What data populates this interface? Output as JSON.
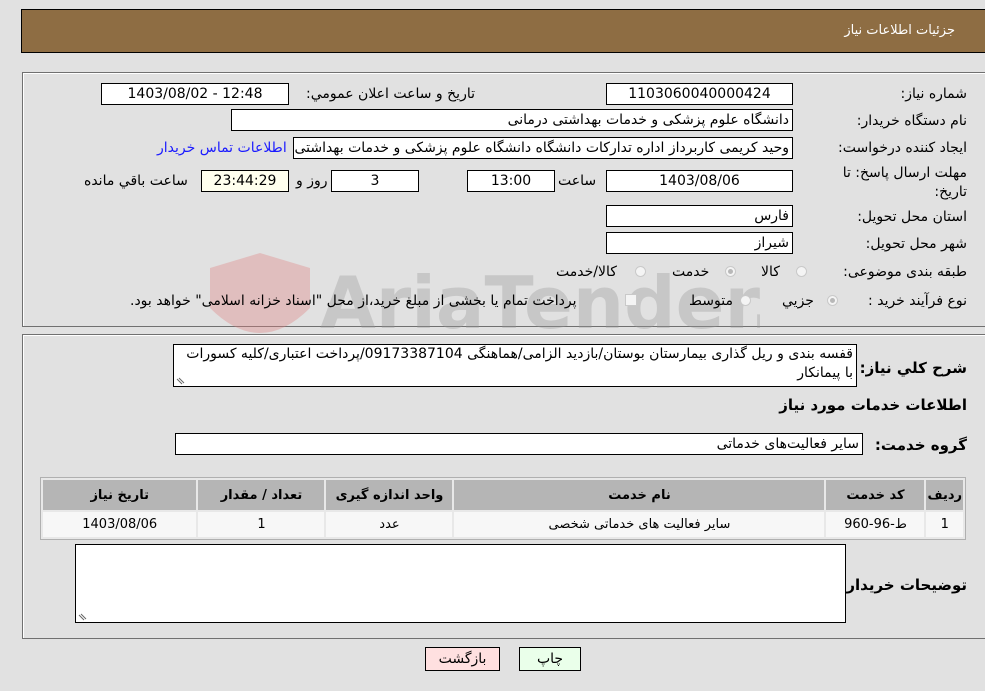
{
  "header": {
    "title": "جزئیات اطلاعات نیاز"
  },
  "form": {
    "need_number": {
      "label": "شماره نیاز:",
      "value": "1103060040000424"
    },
    "announce_datetime": {
      "label": "تاریخ و ساعت اعلان عمومي:",
      "value": "1403/08/02 - 12:48"
    },
    "buyer_org": {
      "label": "نام دستگاه خریدار:",
      "value": "دانشگاه علوم پزشکی و خدمات بهداشتی درمانی"
    },
    "requester": {
      "label": "ایجاد کننده درخواست:",
      "value": "وحید کریمی کاربرداز اداره تدارکات دانشگاه دانشگاه علوم پزشکی و خدمات بهداشتی درمانی",
      "contact_link": "اطلاعات تماس خریدار"
    },
    "deadline": {
      "label": "مهلت ارسال پاسخ: تا تاریخ:",
      "date": "1403/08/06",
      "time_label": "ساعت",
      "time": "13:00",
      "days": "3",
      "days_label": "روز و",
      "remaining": "23:44:29",
      "remaining_label": "ساعت باقي مانده"
    },
    "province": {
      "label": "استان محل تحویل:",
      "value": "فارس"
    },
    "city": {
      "label": "شهر محل تحویل:",
      "value": "شیراز"
    },
    "category": {
      "label": "طبقه بندی موضوعی:",
      "options": [
        {
          "label": "کالا",
          "checked": false
        },
        {
          "label": "خدمت",
          "checked": true
        },
        {
          "label": "کالا/خدمت",
          "checked": false
        }
      ]
    },
    "purchase_type": {
      "label": "نوع فرآیند خرید :",
      "options": [
        {
          "label": "جزيي",
          "checked": true
        },
        {
          "label": "متوسط",
          "checked": false
        }
      ],
      "treasury_checkbox": {
        "label": "پرداخت تمام یا بخشی از مبلغ خرید،از محل \"اسناد خزانه اسلامی\" خواهد بود.",
        "checked": false
      }
    }
  },
  "details": {
    "description_label": "شرح کلي نیاز:",
    "description": "قفسه بندی و ریل گذاری بیمارستان بوستان/بازدید الزامی/هماهنگی 09173387104/پرداخت اعتباری/کلیه کسورات با پیمانکار",
    "services_title": "اطلاعات خدمات مورد نیاز",
    "service_group_label": "گروه خدمت:",
    "service_group": "سایر فعالیت‌های خدماتی",
    "table": {
      "headers": [
        "ردیف",
        "کد خدمت",
        "نام خدمت",
        "واحد اندازه گیری",
        "تعداد / مقدار",
        "تاریخ نیاز"
      ],
      "rows": [
        [
          "1",
          "ط-96-960",
          "سایر فعالیت های خدماتی شخصی",
          "عدد",
          "1",
          "1403/08/06"
        ]
      ]
    },
    "buyer_notes_label": "توضیحات خریدار:",
    "buyer_notes": ""
  },
  "buttons": {
    "print": "چاپ",
    "back": "بازگشت"
  },
  "watermark": "AriaTender.neT",
  "colors": {
    "header_bg": "#8e6d43",
    "back_button_bg": "#ffe0e0",
    "print_button_bg": "#eaffea",
    "link": "#1a1aff"
  }
}
